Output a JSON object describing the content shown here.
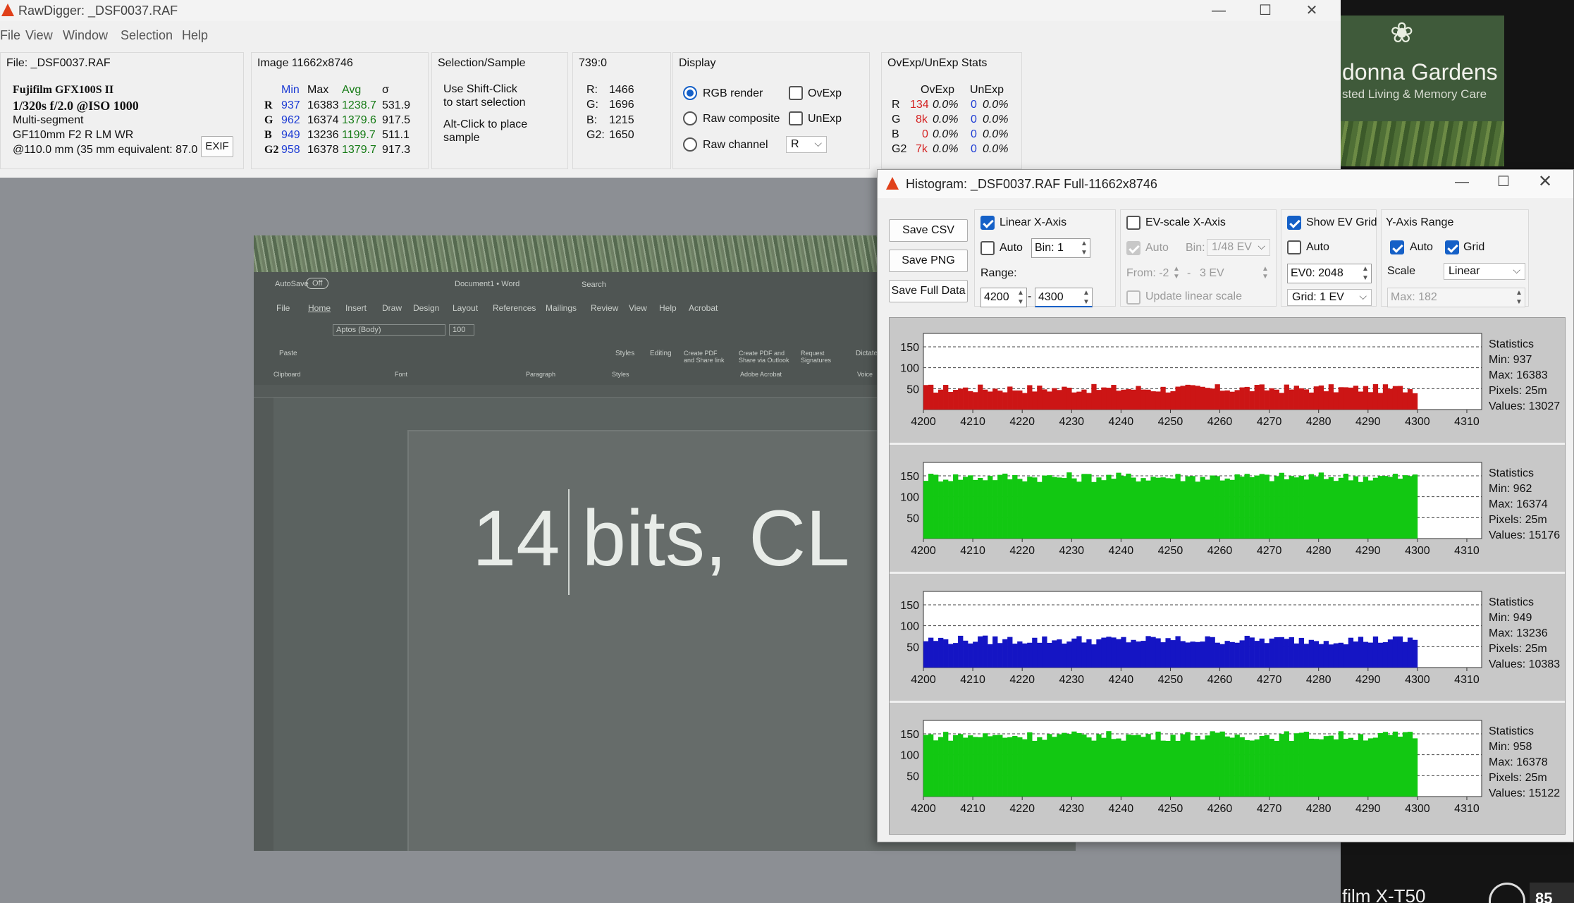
{
  "main": {
    "title": "RawDigger: _DSF0037.RAF",
    "menu": [
      "File",
      "View",
      "Window",
      "Selection",
      "Help"
    ],
    "file_panel": {
      "file_label": "File: _DSF0037.RAF",
      "camera": "Fujifilm GFX100S II",
      "exposure": "1/320s f/2.0 @ISO 1000",
      "mode": "Multi-segment",
      "lens": "GF110mm F2 R LM WR",
      "focal": "@110.0 mm (35 mm equivalent: 87.0",
      "exif_button": "EXIF"
    },
    "image_panel": {
      "title": "Image 11662x8746",
      "headers": [
        "Min",
        "Max",
        "Avg",
        "σ"
      ],
      "rows": [
        {
          "ch": "R",
          "min": "937",
          "max": "16383",
          "avg": "1238.7",
          "sd": "531.9"
        },
        {
          "ch": "G",
          "min": "962",
          "max": "16374",
          "avg": "1379.6",
          "sd": "917.5"
        },
        {
          "ch": "B",
          "min": "949",
          "max": "13236",
          "avg": "1199.7",
          "sd": "511.1"
        },
        {
          "ch": "G2",
          "min": "958",
          "max": "16378",
          "avg": "1379.7",
          "sd": "917.3"
        }
      ]
    },
    "selection_panel": {
      "title": "Selection/Sample",
      "line1": "Use Shift-Click",
      "line2": "to start selection",
      "line3": "Alt-Click to place",
      "line4": "sample"
    },
    "coords_panel": {
      "title": "739:0",
      "rows": [
        {
          "ch": "R:",
          "val": "1466"
        },
        {
          "ch": "G:",
          "val": "1696"
        },
        {
          "ch": "B:",
          "val": "1215"
        },
        {
          "ch": "G2:",
          "val": "1650"
        }
      ]
    },
    "display_panel": {
      "title": "Display",
      "rgb_render": "RGB render",
      "raw_composite": "Raw composite",
      "raw_channel": "Raw channel",
      "ovexp": "OvExp",
      "unexp": "UnExp",
      "channel_value": "R"
    },
    "stats_panel": {
      "title": "OvExp/UnExp Stats",
      "headers": [
        "OvExp",
        "UnExp"
      ],
      "rows": [
        {
          "ch": "R",
          "ov": "134",
          "ovp": "0.0%",
          "un": "0",
          "unp": "0.0%"
        },
        {
          "ch": "G",
          "ov": "8k",
          "ovp": "0.0%",
          "un": "0",
          "unp": "0.0%"
        },
        {
          "ch": "B",
          "ov": "0",
          "ovp": "0.0%",
          "un": "0",
          "unp": "0.0%"
        },
        {
          "ch": "G2",
          "ov": "7k",
          "ovp": "0.0%",
          "un": "0",
          "unp": "0.0%"
        }
      ]
    }
  },
  "photo": {
    "ribbon_tabs": [
      "File",
      "Home",
      "Insert",
      "Draw",
      "Design",
      "Layout",
      "References",
      "Mailings",
      "Review",
      "View",
      "Help",
      "Acrobat"
    ],
    "autosave": "AutoSave",
    "autosave_state": "Off",
    "doc_name": "Document1 • Word",
    "search": "Search",
    "font_name": "Aptos (Body)",
    "font_size": "100",
    "groups": [
      "Clipboard",
      "Font",
      "Paragraph",
      "Styles",
      "Adobe Acrobat",
      "Voice"
    ],
    "paste": "Paste",
    "styles": "Styles",
    "editing": "Editing",
    "create_pdf": "Create PDF and Share link",
    "create_pdf_outlook": "Create PDF and Share via Outlook",
    "request_sig": "Request Signatures",
    "dictate": "Dictate",
    "big_text": "14 bits, CL"
  },
  "background": {
    "site_name": "donna Gardens",
    "site_sub": "sted Living & Memory Care",
    "bottom_text": "film X-T50",
    "bottom_num": "85"
  },
  "histogram": {
    "title": "Histogram: _DSF0037.RAF Full-11662x8746",
    "buttons": {
      "save_csv": "Save CSV",
      "save_png": "Save PNG",
      "save_full": "Save Full Data"
    },
    "linear": {
      "label": "Linear X-Axis",
      "auto": "Auto",
      "bin": "Bin: 1",
      "range_label": "Range:",
      "from": "4200",
      "dash": "-",
      "to": "4300"
    },
    "ev": {
      "label": "EV-scale X-Axis",
      "auto": "Auto",
      "bin_label": "Bin:",
      "bin_value": "1/48 EV",
      "from": "From: -2",
      "dash": "-",
      "to": "3 EV",
      "update": "Update linear scale"
    },
    "evgrid": {
      "label": "Show EV Grid",
      "auto": "Auto",
      "ev0": "EV0: 2048",
      "grid": "Grid: 1 EV"
    },
    "yrange": {
      "label": "Y-Axis Range",
      "auto": "Auto",
      "grid": "Grid",
      "scale_label": "Scale",
      "scale_value": "Linear",
      "max": "Max: 182"
    },
    "stats": [
      {
        "title": "Statistics",
        "min": "Min: 937",
        "max": "Max: 16383",
        "pixels": "Pixels: 25m",
        "values": "Values: 13027"
      },
      {
        "title": "Statistics",
        "min": "Min: 962",
        "max": "Max: 16374",
        "pixels": "Pixels: 25m",
        "values": "Values: 15176"
      },
      {
        "title": "Statistics",
        "min": "Min: 949",
        "max": "Max: 13236",
        "pixels": "Pixels: 25m",
        "values": "Values: 10383"
      },
      {
        "title": "Statistics",
        "min": "Min: 958",
        "max": "Max: 16378",
        "pixels": "Pixels: 25m",
        "values": "Values: 15122"
      }
    ],
    "colors": {
      "R": "#cc1515",
      "G": "#12c812",
      "B": "#1515c4",
      "G2": "#12c812"
    }
  },
  "chart_data": [
    {
      "type": "bar",
      "channel": "R",
      "xlim": [
        4200,
        4313
      ],
      "ylim": [
        0,
        182
      ],
      "xticks": [
        4200,
        4210,
        4220,
        4230,
        4240,
        4250,
        4260,
        4270,
        4280,
        4290,
        4300,
        4310
      ],
      "yticks": [
        50,
        100,
        150
      ],
      "grid": true,
      "x_start": 4200,
      "x_end": 4299,
      "level_mean": 50,
      "level_jitter": 11
    },
    {
      "type": "bar",
      "channel": "G",
      "xlim": [
        4200,
        4313
      ],
      "ylim": [
        0,
        182
      ],
      "xticks": [
        4200,
        4210,
        4220,
        4230,
        4240,
        4250,
        4260,
        4270,
        4280,
        4290,
        4300,
        4310
      ],
      "yticks": [
        50,
        100,
        150
      ],
      "grid": true,
      "x_start": 4200,
      "x_end": 4299,
      "level_mean": 147,
      "level_jitter": 12
    },
    {
      "type": "bar",
      "channel": "B",
      "xlim": [
        4200,
        4313
      ],
      "ylim": [
        0,
        182
      ],
      "xticks": [
        4200,
        4210,
        4220,
        4230,
        4240,
        4250,
        4260,
        4270,
        4280,
        4290,
        4300,
        4310
      ],
      "yticks": [
        50,
        100,
        150
      ],
      "grid": true,
      "x_start": 4200,
      "x_end": 4299,
      "level_mean": 66,
      "level_jitter": 11
    },
    {
      "type": "bar",
      "channel": "G2",
      "xlim": [
        4200,
        4313
      ],
      "ylim": [
        0,
        182
      ],
      "xticks": [
        4200,
        4210,
        4220,
        4230,
        4240,
        4250,
        4260,
        4270,
        4280,
        4290,
        4300,
        4310
      ],
      "yticks": [
        50,
        100,
        150
      ],
      "grid": true,
      "x_start": 4200,
      "x_end": 4299,
      "level_mean": 145,
      "level_jitter": 12
    }
  ]
}
